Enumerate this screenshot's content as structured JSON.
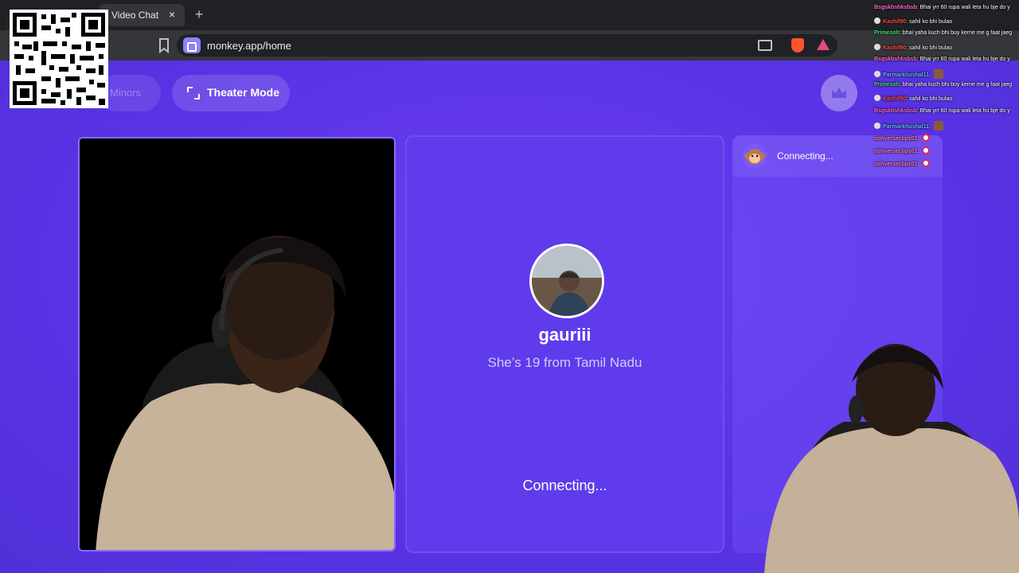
{
  "browser": {
    "tab_title": "Video Chat",
    "tab_close": "×",
    "new_tab": "+",
    "url": "monkey.app/home"
  },
  "page": {
    "minors_label": "Minors",
    "theater_label": "Theater Mode"
  },
  "match": {
    "name": "gauriii",
    "subtitle": "She’s 19 from Tamil Nadu",
    "status": "Connecting..."
  },
  "chat": {
    "status": "Connecting..."
  },
  "stream_chat": [
    {
      "user": "Bsgskbshksbsb",
      "color": "#ff6ad5",
      "badge": false,
      "text": "Bhai yrr 60 rupa wali leta hu bje do y",
      "emote": null
    },
    {
      "user": "Kashif90",
      "color": "#ff4a4a",
      "badge": true,
      "text": "sahil ko bhi bulao",
      "emote": null
    },
    {
      "user": "Primesoh",
      "color": "#3fe06a",
      "badge": false,
      "text": "bhai yaha kuch bhi buy kerne me g faat jaeg",
      "emote": null
    },
    {
      "user": "Kashif90",
      "color": "#ff4a4a",
      "badge": true,
      "text": "sahil ko bhi bulao",
      "emote": null
    },
    {
      "user": "Bsgskbshksbsb",
      "color": "#ff6ad5",
      "badge": false,
      "text": "Bhai yrr 60 rupa wali leta hu bje do y",
      "emote": null
    },
    {
      "user": "Parmarkhushal11",
      "color": "#6ab7ff",
      "badge": true,
      "text": "",
      "emote": "pic"
    },
    {
      "user": "Primesoh",
      "color": "#3fe06a",
      "badge": false,
      "text": "bhai yaha kuch bhi buy kerne me g faat jaeg",
      "emote": null
    },
    {
      "user": "Kashif90",
      "color": "#ff4a4a",
      "badge": true,
      "text": "sahil ko bhi bulao",
      "emote": null
    },
    {
      "user": "Bsgskbshksbsb",
      "color": "#ff6ad5",
      "badge": false,
      "text": "Bhai yrr 60 rupa wali leta hu bje do y",
      "emote": null
    },
    {
      "user": "Parmarkhushal11",
      "color": "#6ab7ff",
      "badge": true,
      "text": "",
      "emote": "pic"
    },
    {
      "user": "sohverseclips01",
      "color": "#ff7ac0",
      "badge": false,
      "text": "",
      "emote": "ring"
    },
    {
      "user": "sohverseclips01",
      "color": "#ff7ac0",
      "badge": false,
      "text": "",
      "emote": "ring"
    },
    {
      "user": "sohverseclips01",
      "color": "#ff7ac0",
      "badge": false,
      "text": "",
      "emote": "ring"
    }
  ],
  "colors": {
    "page_bg": "#5a33e6",
    "tile_bg": "#5f3bec",
    "chrome_bg": "#35363a",
    "accent": "#8b82ff"
  },
  "icons": [
    "close-icon",
    "plus-icon",
    "bookmark-icon",
    "video-icon",
    "cast-icon",
    "brave-icon",
    "warning-icon",
    "expand-icon",
    "crown-icon",
    "monkey-icon",
    "qr-code-icon"
  ]
}
